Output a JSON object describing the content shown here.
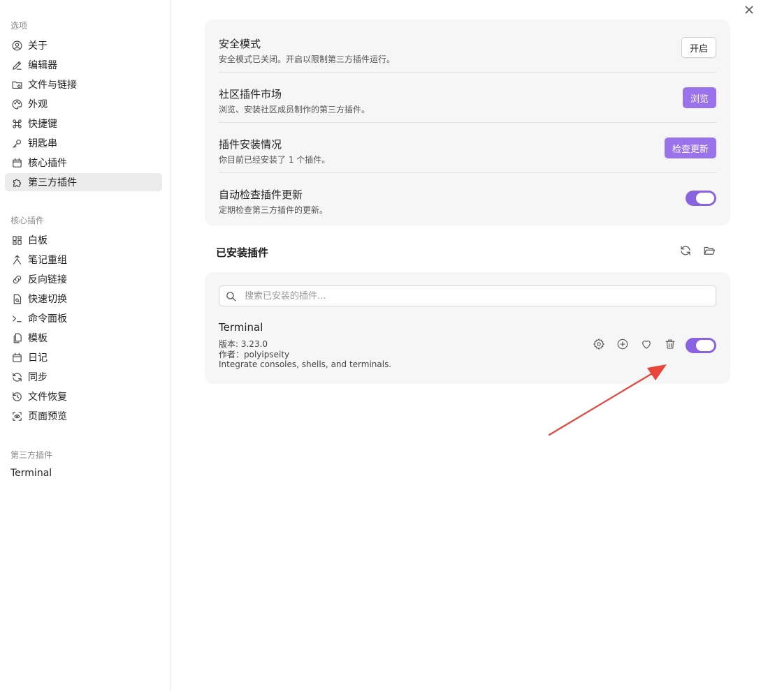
{
  "sidebar": {
    "options_title": "选项",
    "options_items": [
      {
        "label": "关于",
        "icon": "user-circle-icon"
      },
      {
        "label": "编辑器",
        "icon": "pencil-icon"
      },
      {
        "label": "文件与链接",
        "icon": "folder-link-icon"
      },
      {
        "label": "外观",
        "icon": "palette-icon"
      },
      {
        "label": "快捷键",
        "icon": "command-icon"
      },
      {
        "label": "钥匙串",
        "icon": "key-icon"
      },
      {
        "label": "核心插件",
        "icon": "calendar-icon"
      },
      {
        "label": "第三方插件",
        "icon": "puzzle-icon",
        "active": true
      }
    ],
    "core_title": "核心插件",
    "core_items": [
      {
        "label": "白板",
        "icon": "grid-icon"
      },
      {
        "label": "笔记重组",
        "icon": "merge-icon"
      },
      {
        "label": "反向链接",
        "icon": "backlink-icon"
      },
      {
        "label": "快速切换",
        "icon": "file-search-icon"
      },
      {
        "label": "命令面板",
        "icon": "terminal-icon"
      },
      {
        "label": "模板",
        "icon": "files-icon"
      },
      {
        "label": "日记",
        "icon": "calendar-icon"
      },
      {
        "label": "同步",
        "icon": "sync-icon"
      },
      {
        "label": "文件恢复",
        "icon": "history-icon"
      },
      {
        "label": "页面预览",
        "icon": "scan-eye-icon"
      }
    ],
    "third_title": "第三方插件",
    "third_items": [
      {
        "label": "Terminal"
      }
    ]
  },
  "settings": [
    {
      "name": "安全模式",
      "desc": "安全模式已关闭。开启以限制第三方插件运行。",
      "button": "开启",
      "style": "plain"
    },
    {
      "name": "社区插件市场",
      "desc": "浏览、安装社区成员制作的第三方插件。",
      "button": "浏览",
      "style": "accent"
    },
    {
      "name": "插件安装情况",
      "desc": "你目前已经安装了 1 个插件。",
      "button": "检查更新",
      "style": "accent"
    },
    {
      "name": "自动检查插件更新",
      "desc": "定期检查第三方插件的更新。",
      "toggle": true
    }
  ],
  "installed": {
    "title": "已安装插件",
    "search_placeholder": "搜索已安装的插件...",
    "plugin": {
      "name": "Terminal",
      "version": "版本: 3.23.0",
      "author": "作者：polyipseity",
      "description": "Integrate consoles, shells, and terminals.",
      "enabled": true
    }
  },
  "colors": {
    "accent": "#9a72ec",
    "toggle_on": "#8a63e0",
    "annotation_arrow": "#e8453c"
  }
}
